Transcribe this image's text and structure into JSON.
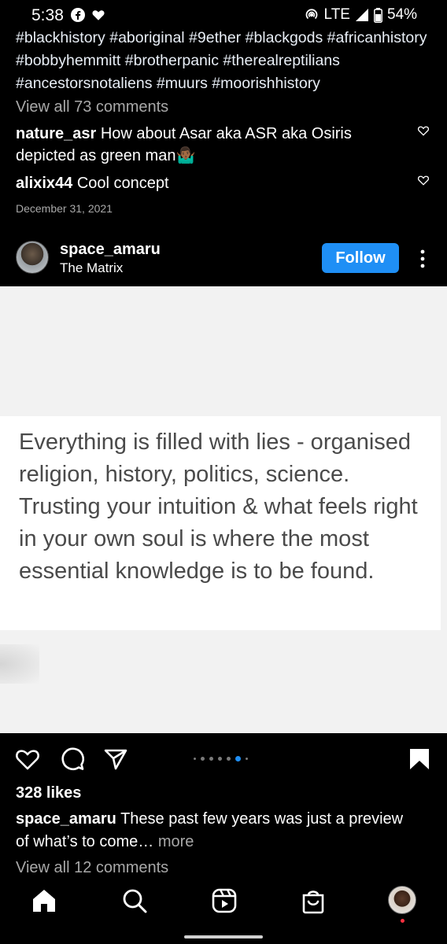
{
  "status_bar": {
    "time": "5:38",
    "network": "LTE",
    "battery": "54%",
    "icons": [
      "facebook-icon",
      "heart-icon",
      "hotspot-icon",
      "signal-icon",
      "battery-icon"
    ]
  },
  "previous_post": {
    "caption_hashtags": "#blackhistory #aboriginal #9ether #blackgods #africanhistory #bobbyhemmitt #brotherpanic #therealreptilians #ancestorsnotaliens #muurs #moorishhistory",
    "view_all_comments": "View all 73 comments",
    "comments": [
      {
        "user": "nature_asr",
        "text": "How about Asar aka ASR aka Osiris depicted as green man🤷🏾‍♂️"
      },
      {
        "user": "alixix44",
        "text": "Cool concept"
      }
    ],
    "date": "December 31, 2021"
  },
  "post": {
    "username": "space_amaru",
    "location": "The Matrix",
    "follow_label": "Follow",
    "image_text": "Everything is filled with lies - organised religion, history, politics, science. Trusting your intuition & what feels right in your own soul is where the most essential knowledge is to be found.",
    "carousel": {
      "count": 7,
      "active_index": 5
    },
    "likes": "328 likes",
    "caption_user": "space_amaru",
    "caption_text": "These past few years was just a preview of what’s to come…",
    "more_label": "more",
    "view_all_comments": "View all 12 comments"
  },
  "colors": {
    "background": "#000000",
    "accent": "#1f8ff5",
    "secondary_text": "#a8a8a8",
    "notification": "#ff3040"
  },
  "bottom_nav": [
    "home-icon",
    "search-icon",
    "reels-icon",
    "shop-icon",
    "profile-avatar"
  ]
}
